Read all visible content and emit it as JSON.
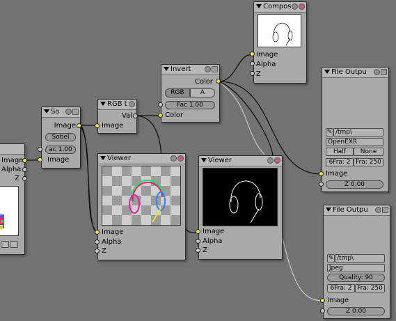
{
  "nodes": {
    "partial": {
      "sockets": [
        "Image",
        "Alpha",
        "Z"
      ]
    },
    "sobel": {
      "title": "So",
      "output": "Image",
      "filter_type": "Sobel",
      "fac": "ac 1.00",
      "input": "Image"
    },
    "rgbtobw": {
      "title": "RGB t",
      "output": "Val",
      "input": "Image"
    },
    "invert": {
      "title": "Invert",
      "output": "Color",
      "rgb_button": "RGB",
      "a_button": "A",
      "fac": "Fac 1.00",
      "input": "Color"
    },
    "composite": {
      "title": "Compos",
      "inputs": [
        "Image",
        "Alpha",
        "Z"
      ]
    },
    "viewer1": {
      "title": "Viewer",
      "inputs": [
        "Image",
        "Alpha",
        "Z"
      ]
    },
    "viewer2": {
      "title": "Viewer",
      "inputs": [
        "Image",
        "Alpha",
        "Z"
      ]
    },
    "fileout1": {
      "title": "File Outpu",
      "path": "/tmp\\",
      "format": "OpenEXR",
      "half": "Half",
      "none": "None",
      "sfra": "6Fra: 2",
      "efra": "Fra: 250",
      "input": "Image",
      "z": "Z 0.00"
    },
    "fileout2": {
      "title": "File Outpu",
      "path": "/tmp\\",
      "format": "Jpeg",
      "quality": "Quality: 90",
      "sfra": "6Fra: 2",
      "efra": "Fra: 250",
      "input": "Image",
      "z": "Z 0.00"
    }
  },
  "colors": {
    "background": "#727272",
    "node_body": "#a9a9a9",
    "socket_image": "#e8e84a",
    "socket_value": "#c8c8c8"
  }
}
